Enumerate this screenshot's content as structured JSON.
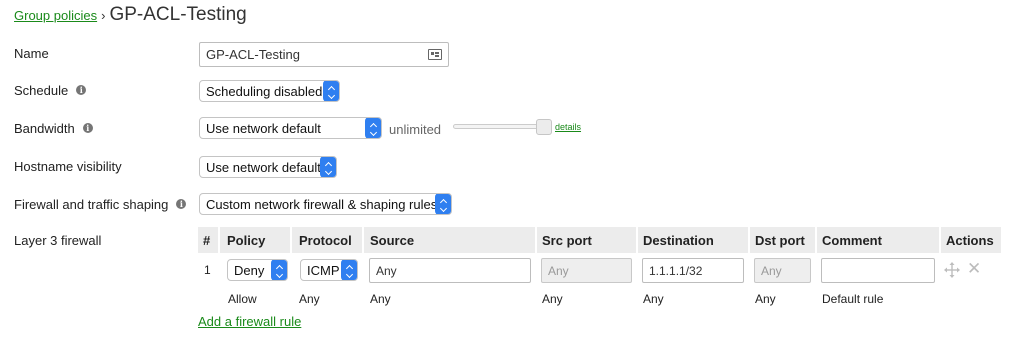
{
  "breadcrumb": {
    "parent": "Group policies",
    "separator": "›",
    "title": "GP-ACL-Testing"
  },
  "fields": {
    "name": {
      "label": "Name",
      "value": "GP-ACL-Testing",
      "icon": "contact-card-icon"
    },
    "schedule": {
      "label": "Schedule",
      "value": "Scheduling disabled"
    },
    "bandwidth": {
      "label": "Bandwidth",
      "value": "Use network default",
      "limit_text": "unlimited",
      "details_link": "details"
    },
    "hostname_visibility": {
      "label": "Hostname visibility",
      "value": "Use network default"
    },
    "firewall_shaping": {
      "label": "Firewall and traffic shaping",
      "value": "Custom network firewall & shaping rules"
    }
  },
  "layer3": {
    "label": "Layer 3 firewall",
    "columns": [
      "#",
      "Policy",
      "Protocol",
      "Source",
      "Src port",
      "Destination",
      "Dst port",
      "Comment",
      "Actions"
    ],
    "rules": [
      {
        "num": "1",
        "policy": "Deny",
        "protocol": "ICMP",
        "source": "Any",
        "src_port": "Any",
        "destination": "1.1.1.1/32",
        "dst_port": "Any",
        "comment": ""
      }
    ],
    "default_rule": {
      "policy": "Allow",
      "protocol": "Any",
      "source": "Any",
      "src_port": "Any",
      "destination": "Any",
      "dst_port": "Any",
      "comment": "Default rule"
    },
    "add_rule_link": "Add a firewall rule"
  },
  "colors": {
    "link": "#1a8a1a",
    "select_accent": "#2f7ff0",
    "table_header_bg": "#ececec",
    "info_icon": "#757575"
  }
}
